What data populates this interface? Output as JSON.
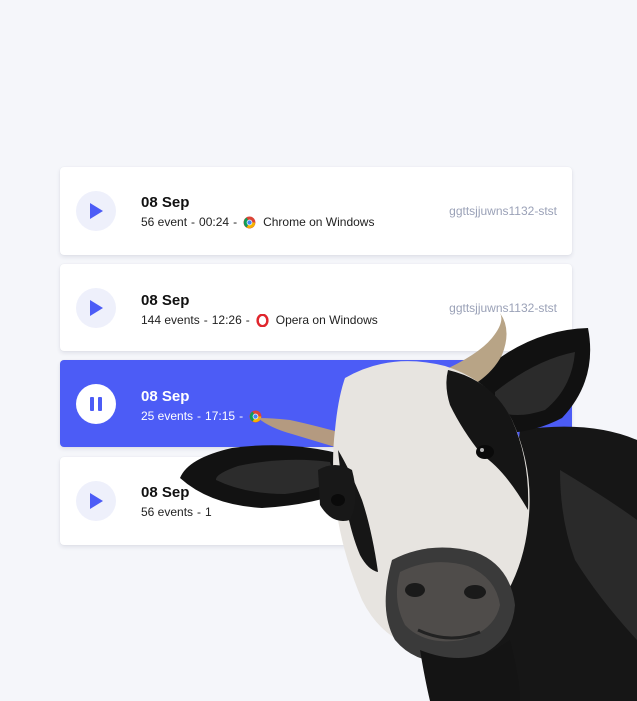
{
  "sessions": [
    {
      "date": "08 Sep",
      "events": "56 event",
      "time": "00:24",
      "browser": "Chrome on Windows",
      "browser_icon": "chrome-icon",
      "id": "ggttsjjuwns1132-stst",
      "state": "paused"
    },
    {
      "date": "08 Sep",
      "events": "144 events",
      "time": "12:26",
      "browser": "Opera on Windows",
      "browser_icon": "opera-icon",
      "id": "ggttsjjuwns1132-stst",
      "state": "paused"
    },
    {
      "date": "08 Sep",
      "events": "25 events",
      "time": "17:15",
      "browser": "",
      "browser_icon": "chrome-icon",
      "id": "",
      "state": "playing"
    },
    {
      "date": "08 Sep",
      "events": "56 events",
      "time": "1",
      "browser": "",
      "browser_icon": "",
      "id": "",
      "state": "paused"
    }
  ],
  "separator": "-",
  "colors": {
    "accent": "#4c5cf6",
    "background": "#f5f6fa",
    "muted_text": "#9aa1b7"
  },
  "decoration": "cow-illustration"
}
